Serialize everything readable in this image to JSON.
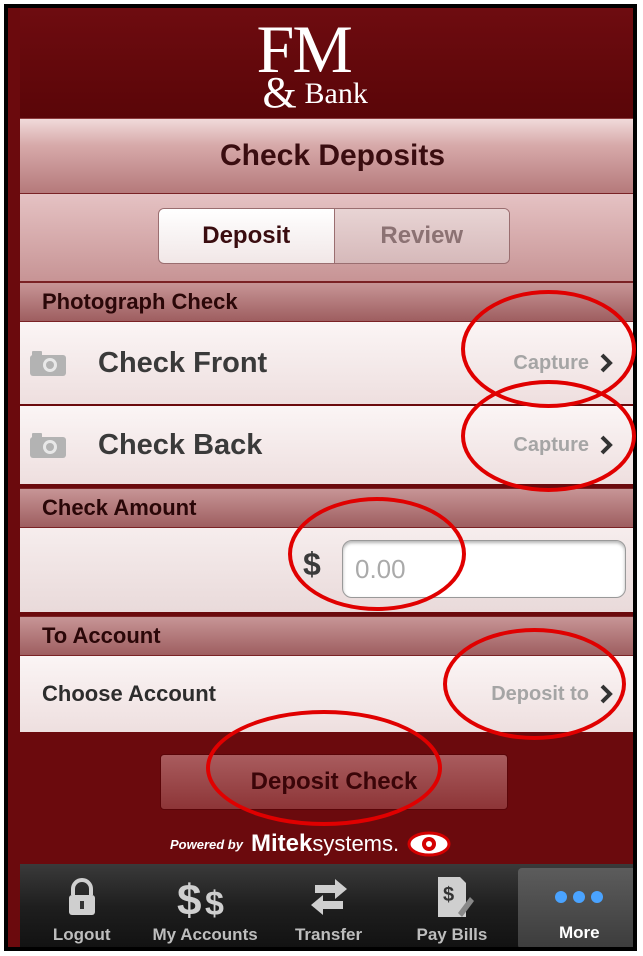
{
  "header": {
    "logo_fm": "FM",
    "logo_amp": "&",
    "logo_bank": "Bank"
  },
  "title": "Check Deposits",
  "tabs": [
    {
      "label": "Deposit",
      "selected": true
    },
    {
      "label": "Review",
      "selected": false
    }
  ],
  "photograph": {
    "section_label": "Photograph Check",
    "front_label": "Check Front",
    "front_action": "Capture",
    "back_label": "Check Back",
    "back_action": "Capture"
  },
  "amount": {
    "section_label": "Check Amount",
    "currency_symbol": "$",
    "placeholder": "0.00"
  },
  "to_account": {
    "section_label": "To Account",
    "choose_label": "Choose Account",
    "action": "Deposit to"
  },
  "deposit_button": "Deposit Check",
  "powered_by": {
    "prefix": "Powered by",
    "brand": "Mitek",
    "suffix": "systems."
  },
  "tabbar": [
    {
      "label": "Logout",
      "icon": "lock-icon"
    },
    {
      "label": "My Accounts",
      "icon": "dollar-signs-icon"
    },
    {
      "label": "Transfer",
      "icon": "transfer-arrows-icon"
    },
    {
      "label": "Pay Bills",
      "icon": "pay-bills-icon"
    },
    {
      "label": "More",
      "icon": "more-dots-icon",
      "selected": true
    }
  ],
  "colors": {
    "brand_maroon": "#6b0a0d",
    "annotation_red": "#e00000"
  }
}
